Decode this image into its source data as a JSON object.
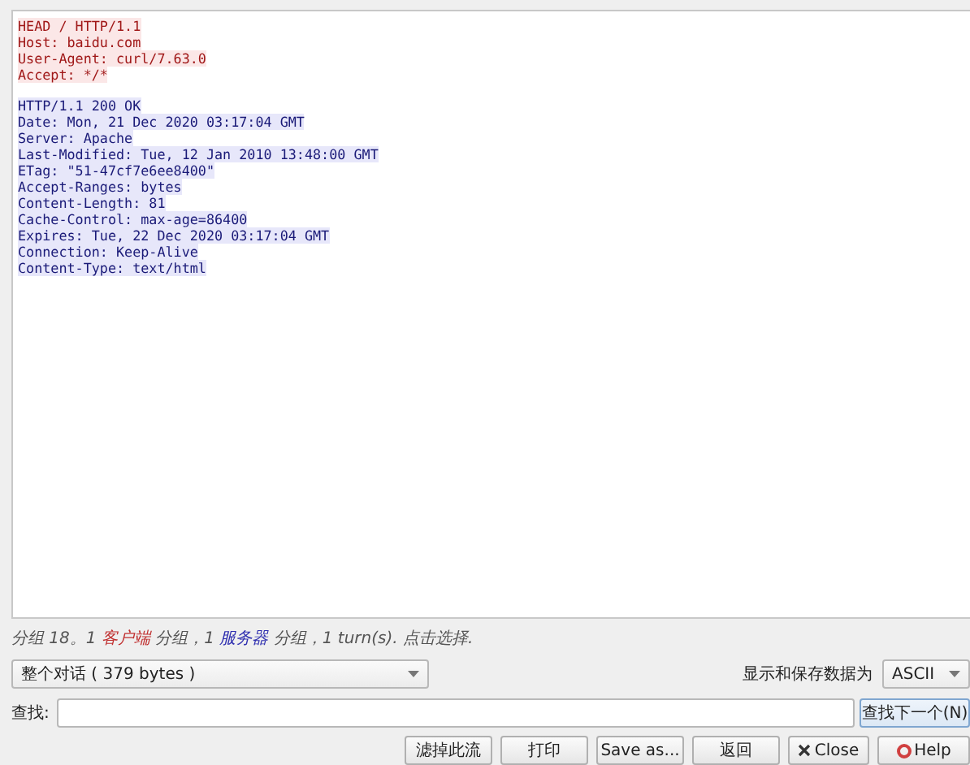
{
  "stream": [
    {
      "kind": "client",
      "lines": [
        "HEAD / HTTP/1.1",
        "Host: baidu.com",
        "User-Agent: curl/7.63.0",
        "Accept: */*"
      ]
    },
    {
      "kind": "server",
      "lines": [
        "HTTP/1.1 200 OK",
        "Date: Mon, 21 Dec 2020 03:17:04 GMT",
        "Server: Apache",
        "Last-Modified: Tue, 12 Jan 2010 13:48:00 GMT",
        "ETag: \"51-47cf7e6ee8400\"",
        "Accept-Ranges: bytes",
        "Content-Length: 81",
        "Cache-Control: max-age=86400",
        "Expires: Tue, 22 Dec 2020 03:17:04 GMT",
        "Connection: Keep-Alive",
        "Content-Type: text/html"
      ]
    }
  ],
  "status": [
    {
      "text": "分组 18。1 "
    },
    {
      "text": "客户端",
      "color": "#c03030"
    },
    {
      "text": " 分组，1 "
    },
    {
      "text": "服务器",
      "color": "#3030b0"
    },
    {
      "text": " 分组，1 turn(s). 点击选择."
    }
  ],
  "conversation_select": {
    "value": "整个对话 ( 379 bytes )"
  },
  "format_label": "显示和保存数据为",
  "format_select": {
    "value": "ASCII"
  },
  "find": {
    "label": "查找:",
    "button": "查找下一个(N)"
  },
  "buttons": [
    {
      "kind": "plain",
      "label": "滤掉此流"
    },
    {
      "kind": "plain",
      "label": "打印"
    },
    {
      "kind": "plain",
      "label": "Save as..."
    },
    {
      "kind": "plain",
      "label": "返回"
    },
    {
      "kind": "close",
      "label": "Close"
    },
    {
      "kind": "help",
      "label": "Help"
    }
  ]
}
